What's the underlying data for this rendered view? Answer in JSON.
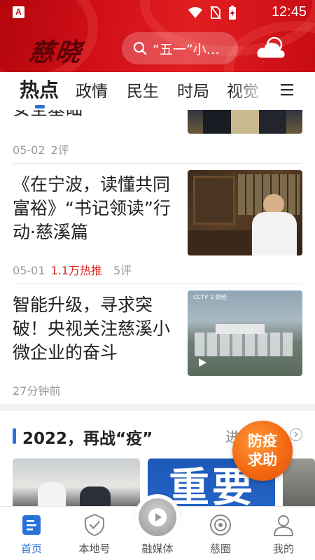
{
  "status_bar": {
    "time": "12:45",
    "app_icon_letter": "A"
  },
  "header": {
    "logo_text": "慈晓",
    "search_placeholder": "“五一”小…",
    "weather_icon": "cloud-icon"
  },
  "tabs": [
    {
      "label": "热点",
      "active": true
    },
    {
      "label": "政情",
      "active": false
    },
    {
      "label": "民生",
      "active": false
    },
    {
      "label": "时局",
      "active": false
    },
    {
      "label": "视觉",
      "active": false
    }
  ],
  "feed": {
    "items": [
      {
        "title_partial": "安全基础",
        "date": "05-02",
        "comments": "2评"
      },
      {
        "title": "《在宁波，读懂共同富裕》“书记领读”行动·慈溪篇",
        "date": "05-01",
        "hot": "1.1万热推",
        "comments": "5评"
      },
      {
        "title": "智能升级，寻求突破！央视关注慈溪小微企业的奋斗",
        "time": "27分钟前",
        "thumb_caption": "CCTV 2 财经"
      }
    ],
    "section": {
      "title": "2022，再战“疫”",
      "more": "进入",
      "card_text": "重要"
    }
  },
  "floating_badge": {
    "line1": "防疫",
    "line2": "求助"
  },
  "bottom_nav": [
    {
      "label": "首页",
      "icon": "home-doc-icon",
      "active": true
    },
    {
      "label": "本地号",
      "icon": "check-badge-icon",
      "active": false
    },
    {
      "label": "融媒体",
      "icon": "play-icon",
      "active": false
    },
    {
      "label": "慈圈",
      "icon": "target-icon",
      "active": false
    },
    {
      "label": "我的",
      "icon": "user-icon",
      "active": false
    }
  ],
  "colors": {
    "brand_red": "#d4101a",
    "accent_blue": "#2a72d8",
    "hot_red": "#d9261c",
    "badge_orange": "#f36a12"
  }
}
